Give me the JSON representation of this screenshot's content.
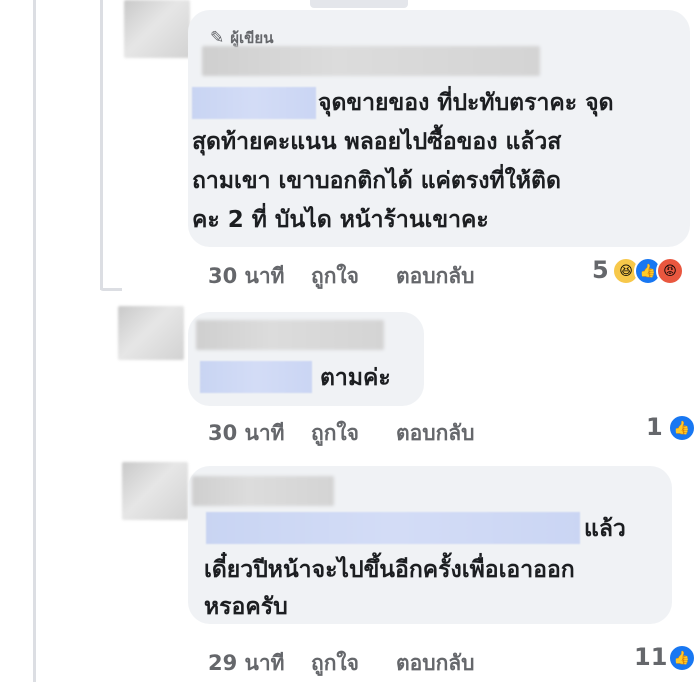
{
  "thread": {
    "comments": [
      {
        "author_badge": "ผู้เขียน",
        "text_line1": "จุดขายของ ที่ปะทับตราคะ จุด",
        "text_line2": "สุดท้ายคะแนน พลอยไปซื้อของ แล้วส",
        "text_line3": "ถามเขา เขาบอกติกได้ แค่ตรงที่ให้ติด",
        "text_line4": "คะ 2 ที่ บันได หน้าร้านเขาคะ",
        "time": "30 นาที",
        "like_label": "ถูกใจ",
        "reply_label": "ตอบกลับ",
        "reaction_count": "5",
        "reactions": [
          "haha-icon",
          "like-icon",
          "angry-icon"
        ]
      },
      {
        "text_line1": "ตามค่ะ",
        "time": "30 นาที",
        "like_label": "ถูกใจ",
        "reply_label": "ตอบกลับ",
        "reaction_count": "1",
        "reactions": [
          "like-icon"
        ]
      },
      {
        "text_line1": "แล้ว",
        "text_line2": "เดี๋ยวปีหน้าจะไปขึ้นอีกครั้งเพื่อเอาออก",
        "text_line3": "หรอครับ",
        "time": "29 นาที",
        "like_label": "ถูกใจ",
        "reply_label": "ตอบกลับ",
        "reaction_count": "11",
        "reactions": [
          "like-icon"
        ]
      }
    ]
  },
  "colors": {
    "bubble": "#f0f2f5",
    "meta_text": "#65676b",
    "like_blue": "#1877f2",
    "mention_highlight": "#d3dcf6"
  }
}
